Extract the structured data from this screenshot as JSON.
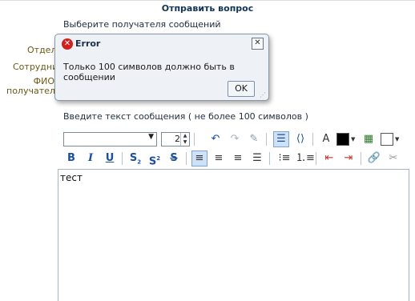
{
  "page": {
    "title": "Отправить вопрос",
    "recipients_caption": "Выберите получателя сообщений",
    "labels": {
      "department": "Отдел",
      "employee": "Сотрудник",
      "fio_line1": "ФИО",
      "fio_line2": "получателя"
    },
    "message_caption": "Введите текст сообщения ( не более 100 символов )"
  },
  "toolbar": {
    "font_family_value": "",
    "font_size_value": "2",
    "bold": "B",
    "italic": "I",
    "underline": "U",
    "subscript": "S",
    "superscript": "S",
    "strike": "S",
    "text_color": "#000000",
    "bg_color": "#ffffff"
  },
  "editor": {
    "content": "тест"
  },
  "dialog": {
    "title": "Error",
    "message": "Только 100 символов должно быть в сообщении",
    "ok_label": "OK",
    "close_glyph": "✕"
  }
}
